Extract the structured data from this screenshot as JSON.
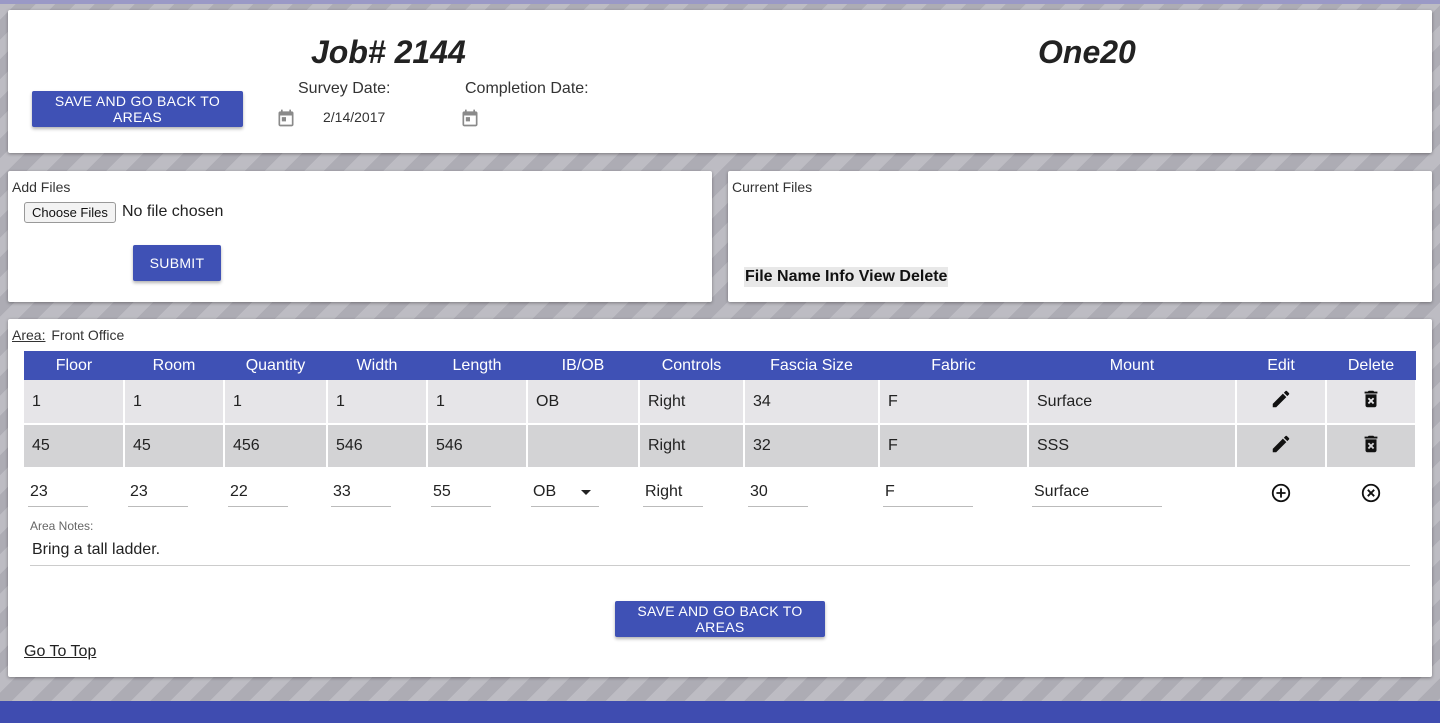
{
  "header": {
    "job_title": "Job# 2144",
    "company": "One20",
    "save_button": "SAVE AND GO BACK TO AREAS",
    "survey_date_label": "Survey Date:",
    "survey_date_value": "2/14/2017",
    "completion_date_label": "Completion Date:",
    "completion_date_value": ""
  },
  "add_files": {
    "title": "Add Files",
    "choose_button": "Choose Files",
    "no_file": "No file chosen",
    "submit": "SUBMIT"
  },
  "current_files": {
    "title": "Current Files",
    "columns": "File Name Info View Delete"
  },
  "area": {
    "label": "Area:",
    "name": "Front Office",
    "columns": [
      "Floor",
      "Room",
      "Quantity",
      "Width",
      "Length",
      "IB/OB",
      "Controls",
      "Fascia Size",
      "Fabric",
      "Mount",
      "Edit",
      "Delete"
    ],
    "rows": [
      [
        "1",
        "1",
        "1",
        "1",
        "1",
        "OB",
        "Right",
        "34",
        "F",
        "Surface"
      ],
      [
        "45",
        "45",
        "456",
        "546",
        "546",
        "",
        "Right",
        "32",
        "F",
        "SSS"
      ]
    ],
    "edit_row": [
      "23",
      "23",
      "22",
      "33",
      "55",
      "OB",
      "Right",
      "30",
      "F",
      "Surface"
    ],
    "notes_label": "Area Notes:",
    "notes_value": "Bring a tall ladder.",
    "save_button": "SAVE AND GO BACK TO AREAS",
    "go_to_top": "Go To Top"
  },
  "colors": {
    "primary": "#3f51b5",
    "row_light": "#e6e5e8",
    "row_dark": "#d3d3d5"
  }
}
